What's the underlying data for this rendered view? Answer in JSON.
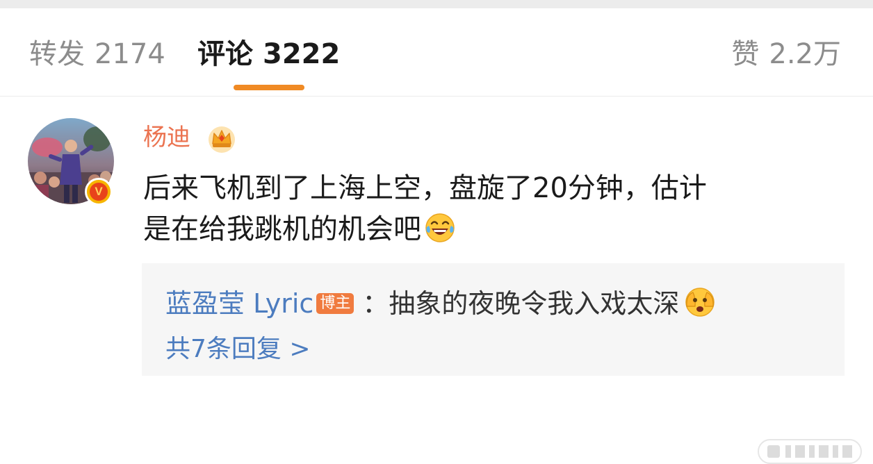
{
  "tabs": {
    "repost_label": "转发",
    "repost_count": "2174",
    "comments_label": "评论",
    "comments_count": "3222",
    "likes_label": "赞",
    "likes_count": "2.2万",
    "active": "comments"
  },
  "comment": {
    "author": "杨迪",
    "verified_badge": "V",
    "vip_icon": "crown-icon",
    "text_line1": "后来飞机到了上海上空，盘旋了20分钟，估计",
    "text_line2": "是在给我跳机的机会吧",
    "emoji": "laughing-tears-emoji"
  },
  "reply": {
    "author": "蓝盈莹 Lyric",
    "tag": "博主",
    "separator": "：",
    "text": "抽象的夜晚令我入戏太深",
    "emoji": "face-covering-emoji",
    "more_replies": "共7条回复 >"
  },
  "colors": {
    "accent_orange": "#f08a24",
    "username_orange": "#eb7350",
    "link_blue": "#4c7cbf",
    "reply_bg": "#f6f6f6"
  }
}
